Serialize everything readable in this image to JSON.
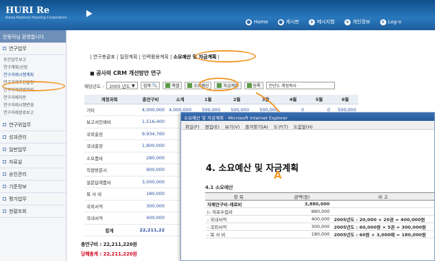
{
  "header": {
    "logo_title": "HURI Re",
    "logo_sub": "Korea National Housing Corporation",
    "nav": [
      {
        "icon": "●",
        "label": "Home"
      },
      {
        "icon": "●",
        "label": "게시판"
      },
      {
        "icon": "+",
        "label": "메시지함"
      },
      {
        "icon": "+",
        "label": "개인정보"
      },
      {
        "icon": "+",
        "label": "Log-o"
      }
    ]
  },
  "sidebar": {
    "welcome": "안동덕님 환영합니다.",
    "sections": [
      {
        "label": "연구업무",
        "items": [
          "주간업무보고",
          "연구계획/선정",
          "연구과제시행계획",
          "연구과제추진일정",
          "연구과제관련회의",
          "연구과제자문",
          "연구과제시행변경",
          "연구과제완료보고"
        ],
        "active": 2
      },
      {
        "label": "연구외업무",
        "items": []
      },
      {
        "label": "성과관리",
        "items": []
      },
      {
        "label": "일반업무",
        "items": []
      },
      {
        "label": "자료실",
        "items": []
      },
      {
        "label": "승인관리",
        "items": []
      },
      {
        "label": "기준정보",
        "items": []
      },
      {
        "label": "평가업무",
        "items": []
      },
      {
        "label": "현황조회",
        "items": []
      }
    ]
  },
  "main": {
    "tabs": "| 연구총괄표 | 일정계획 | 인력활용계획 | ",
    "active_tab": "소요예산 및 자금계획",
    "title": "공사의 CRM 개선방안 연구",
    "filter": {
      "label": "해당년도 :",
      "year": "2005 년도",
      "search": "검색",
      "excel": "엑셀",
      "budget": "소요예산",
      "fund": "자금계획",
      "register": "등록",
      "copy": "전년도 계정복사"
    },
    "columns": [
      "계정과목",
      "총연구비",
      "소계",
      "1월",
      "2월",
      "3월",
      "4월",
      "5월",
      "6월"
    ],
    "rows": [
      {
        "name": "기타",
        "total": "4,000,000",
        "sub": "4,000,000",
        "m1": "500,000",
        "m2": "500,000",
        "m3": "500,000",
        "m4": "0",
        "m5": "0",
        "m6": "500,000"
      },
      {
        "name": "보고서인쇄비",
        "total": "1,516,400",
        "sub": "",
        "m1": "",
        "m2": "",
        "m3": "",
        "m4": "",
        "m5": "",
        "m6": ""
      },
      {
        "name": "국외출장",
        "total": "9,934,760",
        "sub": "",
        "m1": "",
        "m2": "",
        "m3": "",
        "m4": "",
        "m5": "",
        "m6": ""
      },
      {
        "name": "국내출장",
        "total": "1,800,000",
        "sub": "",
        "m1": "",
        "m2": "",
        "m3": "",
        "m4": "",
        "m5": "",
        "m6": ""
      },
      {
        "name": "소모품비",
        "total": "280,000",
        "sub": "",
        "m1": "",
        "m2": "",
        "m3": "",
        "m4": "",
        "m5": "",
        "m6": ""
      },
      {
        "name": "직원방문시",
        "total": "900,000",
        "sub": "",
        "m1": "",
        "m2": "",
        "m3": "",
        "m4": "",
        "m5": "",
        "m6": ""
      },
      {
        "name": "설문답례품비",
        "total": "3,000,000",
        "sub": "",
        "m1": "",
        "m2": "",
        "m3": "",
        "m4": "",
        "m5": "",
        "m6": ""
      },
      {
        "name": "복 사 비",
        "total": "180,000",
        "sub": "",
        "m1": "",
        "m2": "",
        "m3": "",
        "m4": "",
        "m5": "",
        "m6": ""
      },
      {
        "name": "국외서적",
        "total": "300,000",
        "sub": "",
        "m1": "",
        "m2": "",
        "m3": "",
        "m4": "",
        "m5": "",
        "m6": ""
      },
      {
        "name": "국내서적",
        "total": "400,000",
        "sub": "",
        "m1": "",
        "m2": "",
        "m3": "",
        "m4": "",
        "m5": "",
        "m6": ""
      },
      {
        "name": "합계",
        "total": "22,211,22",
        "sub": "",
        "m1": "",
        "m2": "",
        "m3": "",
        "m4": "",
        "m5": "",
        "m6": ""
      }
    ],
    "total_label": "총연구비 : 22,211,220원",
    "sum_label": "당해총계 : 22,211,220원"
  },
  "popup": {
    "title": "소요예산 및 자금계획 - Microsoft Internet Explorer",
    "menu": [
      "파일(F)",
      "편집(E)",
      "보기(V)",
      "즐겨찾기(A)",
      "도구(T)",
      "도움말(H)"
    ],
    "heading": "4. 소요예산 및 자금계획",
    "subheading": "4.1 소요예산",
    "cols": [
      "항 목",
      "금액(원)",
      "비 고"
    ],
    "rows": [
      {
        "item": "자체연구비-재료비",
        "amount": "3,880,000",
        "note": ""
      },
      {
        "item": "▷ 자료수집비",
        "amount": "880,000",
        "note": ""
      },
      {
        "item": "- 국내서적",
        "amount": "400,000",
        "note": "2005년도 : 20,000 × 20권 = 400,000원"
      },
      {
        "item": "- 국외서적",
        "amount": "300,000",
        "note": "2005년도 : 60,000원 × 5권 = 300,000원"
      },
      {
        "item": "- 복 사 비",
        "amount": "180,000",
        "note": "2005년도 : 60원 × 3,000매 = 180,000원"
      }
    ]
  },
  "annotation": {
    "label": "A"
  },
  "colors": {
    "header": "#1d5d9c",
    "highlight": "#f29a2c",
    "link": "#2a4fa3",
    "sum_red": "#d0021b"
  }
}
